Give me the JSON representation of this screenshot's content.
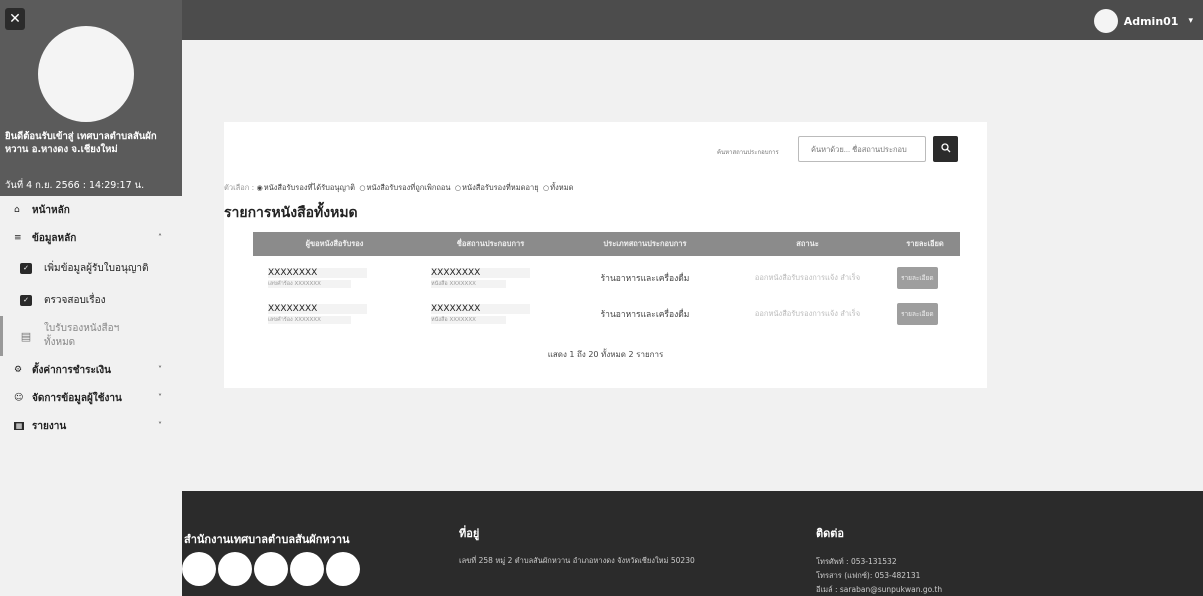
{
  "topbar": {
    "username": "Admin01",
    "caret": "▾"
  },
  "sidebar": {
    "close_icon": "✕",
    "welcome": "ยินดีต้อนรับเข้าสู่ เทศบาลตำบลสันผักหวาน อ.หางดง จ.เชียงใหม่",
    "datetime": "วันที่ 4 ก.ย. 2566 : 14:29:17 น.",
    "menu": {
      "home": "หน้าหลัก",
      "master": "ข้อมูลหลัก",
      "add_licensee": "เพิ่มข้อมูลผู้รับใบอนุญาติ",
      "check": "ตรวจสอบเรื่อง",
      "certs_all": "ใบรับรองหนังสือฯ ทั้งหมด",
      "payment": "ตั้งค่าการชำระเงิน",
      "users": "จัดการข้อมูลผู้ใช้งาน",
      "report": "รายงาน"
    }
  },
  "search": {
    "label": "ค้นหาสถานประกอบการ",
    "placeholder": "ค้นหาด้วย... ชื่อสถานประกอบ"
  },
  "filter": {
    "lead": "ตัวเลือก :",
    "options": [
      {
        "label": "หนังสือรับรองที่ได้รับอนุญาติ",
        "selected": true
      },
      {
        "label": "หนังสือรับรองที่ถูกเพิกถอน",
        "selected": false
      },
      {
        "label": "หนังสือรับรองที่หมดอายุ",
        "selected": false
      },
      {
        "label": "ทั้งหมด",
        "selected": false
      }
    ]
  },
  "list_title": "รายการหนังสือทั้งหมด",
  "table": {
    "headers": [
      "ผู้ขอหนังสือรับรอง",
      "ชื่อสถานประกอบการ",
      "ประเภทสถานประกอบการ",
      "สถานะ",
      "รายละเอียด"
    ],
    "rows": [
      {
        "applicant": "XXXXXXXX",
        "applicant_sub": "เลขคำร้อง XXXXXXX",
        "place": "XXXXXXXX",
        "place_sub": "หนังสือ XXXXXXX",
        "type": "ร้านอาหารและเครื่องดื่ม",
        "status": "ออกหนังสือรับรองการแจ้ง สำเร็จ",
        "detail": "รายละเอียด"
      },
      {
        "applicant": "XXXXXXXX",
        "applicant_sub": "เลขคำร้อง XXXXXXX",
        "place": "XXXXXXXX",
        "place_sub": "หนังสือ XXXXXXX",
        "type": "ร้านอาหารและเครื่องดื่ม",
        "status": "ออกหนังสือรับรองการแจ้ง สำเร็จ",
        "detail": "รายละเอียด"
      }
    ],
    "summary": "แสดง 1 ถึง 20 ทั้งหมด 2 รายการ"
  },
  "footer": {
    "org": "สำนักงานเทศบาลตำบลสันผักหวาน",
    "address_heading": "ที่อยู่",
    "address": "เลขที่ 258 หมู่ 2 ตำบลสันผักหวาน อำเภอหางดง จังหวัดเชียงใหม่ 50230",
    "contact_heading": "ติดต่อ",
    "phone": "โทรศัพท์ : 053-131532",
    "fax": "โทรสาร (แฟกซ์): 053-482131",
    "email": "อีเมล์ : saraban@sunpukwan.go.th"
  },
  "icons": {
    "close": "close-icon",
    "search": "search-icon",
    "home": "home-icon",
    "database": "database-icon",
    "checkbox": "checkbox-icon",
    "document": "document-icon",
    "settings": "gear-icon",
    "users": "users-icon",
    "report": "report-icon"
  }
}
